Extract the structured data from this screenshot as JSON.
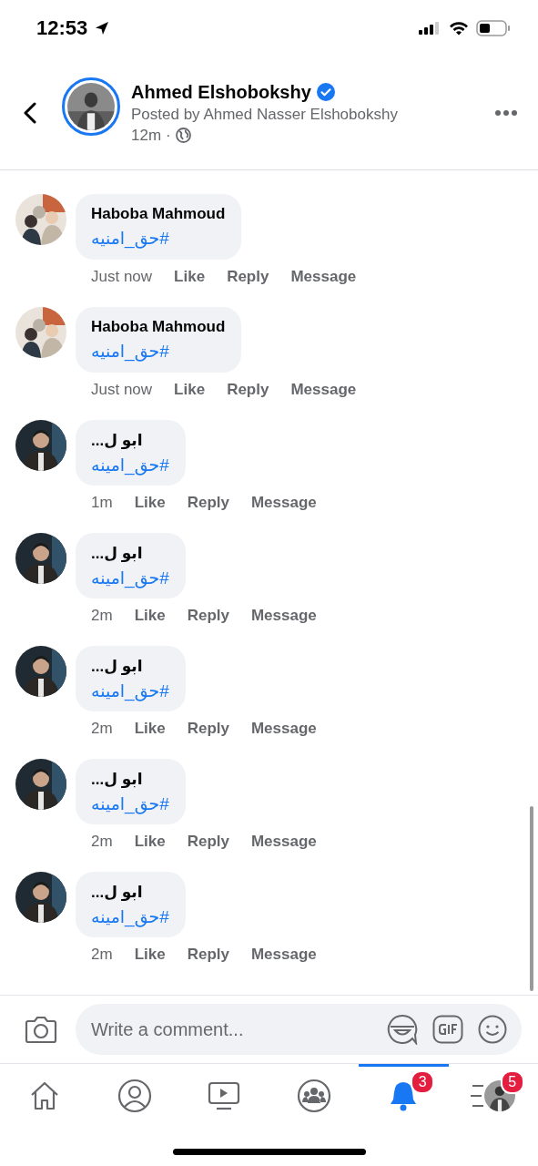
{
  "status_bar": {
    "time": "12:53"
  },
  "header": {
    "name": "Ahmed Elshobokshy",
    "verified": true,
    "posted_by": "Posted by Ahmed Nasser Elshobokshy",
    "time": "12m",
    "separator": "·"
  },
  "comments": [
    {
      "author": "Haboba Mahmoud",
      "text": "#حق_امنيه",
      "time": "Just now",
      "actions": [
        "Like",
        "Reply",
        "Message"
      ]
    },
    {
      "author": "Haboba Mahmoud",
      "text": "#حق_امنيه",
      "time": "Just now",
      "actions": [
        "Like",
        "Reply",
        "Message"
      ]
    },
    {
      "author": "ابو ل...",
      "text": "#حق_امينه",
      "time": "1m",
      "actions": [
        "Like",
        "Reply",
        "Message"
      ]
    },
    {
      "author": "ابو ل...",
      "text": "#حق_امينه",
      "time": "2m",
      "actions": [
        "Like",
        "Reply",
        "Message"
      ]
    },
    {
      "author": "ابو ل...",
      "text": "#حق_امينه",
      "time": "2m",
      "actions": [
        "Like",
        "Reply",
        "Message"
      ]
    },
    {
      "author": "ابو ل...",
      "text": "#حق_امينه",
      "time": "2m",
      "actions": [
        "Like",
        "Reply",
        "Message"
      ]
    },
    {
      "author": "ابو ل...",
      "text": "#حق_امينه",
      "time": "2m",
      "actions": [
        "Like",
        "Reply",
        "Message"
      ]
    }
  ],
  "composer": {
    "placeholder": "Write a comment..."
  },
  "tabs": [
    {
      "kind": "home",
      "selected": false
    },
    {
      "kind": "profile",
      "selected": false
    },
    {
      "kind": "video",
      "selected": false
    },
    {
      "kind": "groups",
      "selected": false
    },
    {
      "kind": "notifications",
      "selected": true,
      "badge": "3"
    },
    {
      "kind": "menu",
      "selected": false,
      "badge": "5"
    }
  ]
}
